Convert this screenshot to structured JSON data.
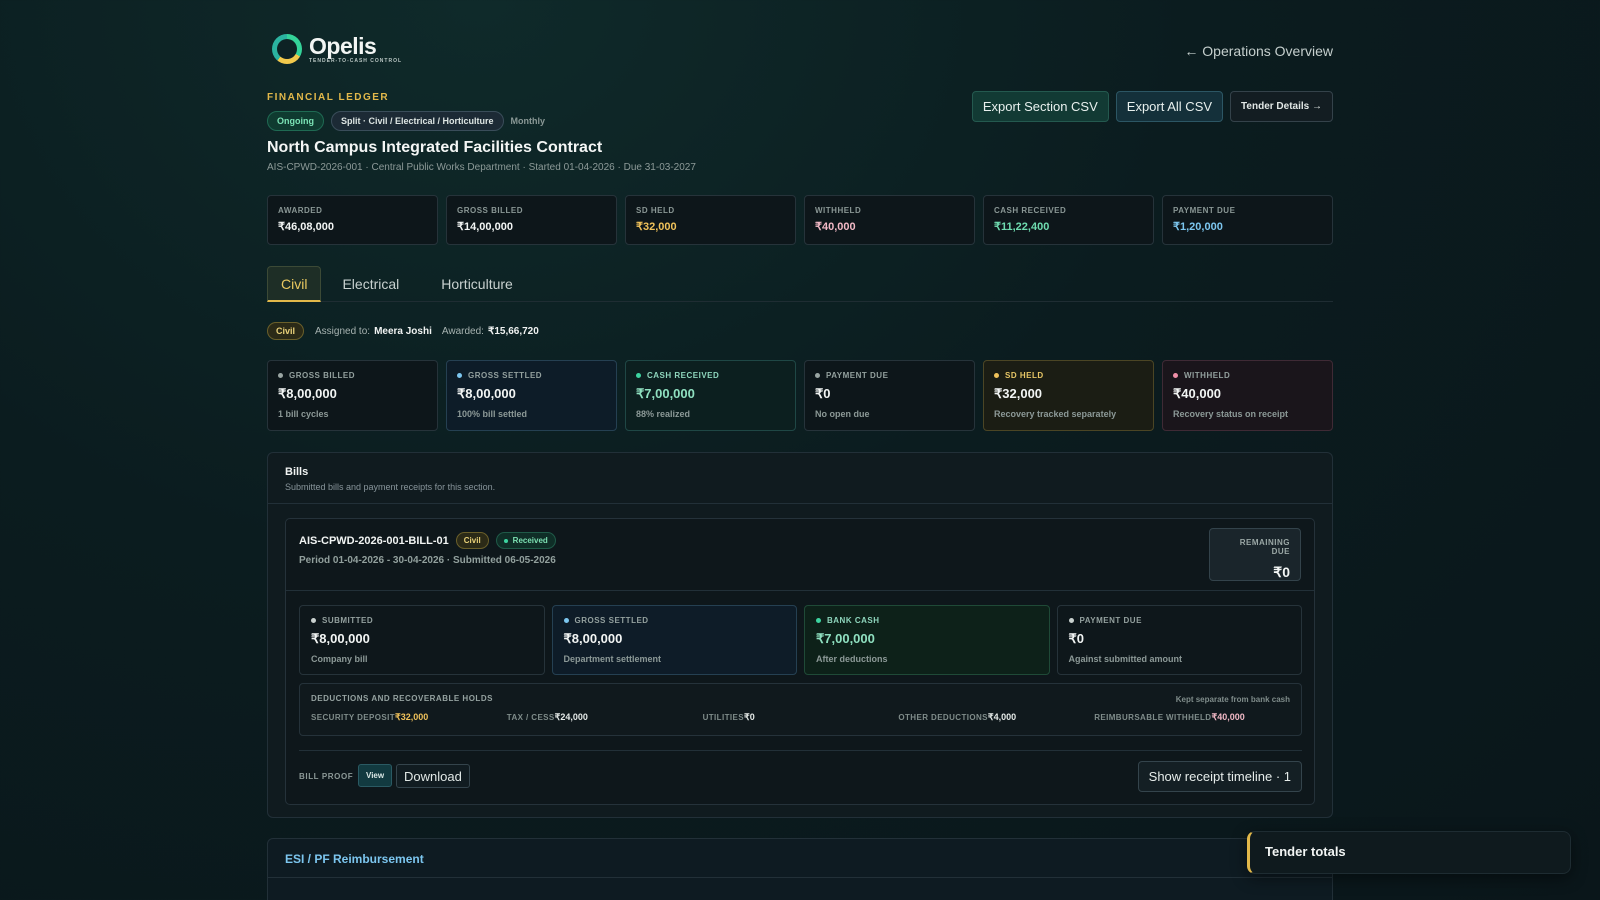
{
  "brand": {
    "name": "Opelis",
    "tagline": "TENDER-TO-CASH CONTROL"
  },
  "nav": {
    "back_link": "← Operations Overview"
  },
  "header": {
    "eyebrow": "FINANCIAL LEDGER",
    "status": "Ongoing",
    "split": "Split · Civil / Electrical / Horticulture",
    "frequency": "Monthly",
    "title": "North Campus Integrated Facilities Contract",
    "subtitle": "AIS-CPWD-2026-001 · Central Public Works Department · Started 01-04-2026 · Due 31-03-2027"
  },
  "actions": {
    "export_section": "Export Section CSV",
    "export_all": "Export All CSV",
    "tender_details": "Tender Details →"
  },
  "summary": [
    {
      "label": "AWARDED",
      "value": "₹46,08,000",
      "color": "#f2f5f4"
    },
    {
      "label": "GROSS BILLED",
      "value": "₹14,00,000",
      "color": "#f2f5f4"
    },
    {
      "label": "SD HELD",
      "value": "₹32,000",
      "color": "#f0c25a"
    },
    {
      "label": "WITHHELD",
      "value": "₹40,000",
      "color": "#f2b9c6"
    },
    {
      "label": "CASH RECEIVED",
      "value": "₹11,22,400",
      "color": "#6fdcb0"
    },
    {
      "label": "PAYMENT DUE",
      "value": "₹1,20,000",
      "color": "#7cc6ef"
    }
  ],
  "tabs": [
    {
      "label": "Civil",
      "active": true
    },
    {
      "label": "Electrical",
      "active": false
    },
    {
      "label": "Horticulture",
      "active": false
    }
  ],
  "section": {
    "badge": "Civil",
    "assigned_label": "Assigned to:",
    "assigned_to": "Meera Joshi",
    "awarded_label": "Awarded:",
    "awarded_value": "₹15,66,720"
  },
  "metrics": [
    {
      "label": "GROSS BILLED",
      "value": "₹8,00,000",
      "note": "1 bill cycles",
      "dot": "#9aa5a3"
    },
    {
      "label": "GROSS SETTLED",
      "value": "₹8,00,000",
      "note": "100% bill settled",
      "dot": "#7cc6ef"
    },
    {
      "label": "CASH RECEIVED",
      "value": "₹7,00,000",
      "note": "88% realized",
      "dot": "#3dd4a0"
    },
    {
      "label": "PAYMENT DUE",
      "value": "₹0",
      "note": "No open due",
      "dot": "#9aa5a3"
    },
    {
      "label": "SD HELD",
      "value": "₹32,000",
      "note": "Recovery tracked separately",
      "dot": "#f0c25a"
    },
    {
      "label": "WITHHELD",
      "value": "₹40,000",
      "note": "Recovery status on receipt",
      "dot": "#f08fa8"
    }
  ],
  "bills_section": {
    "title": "Bills",
    "subtitle": "Submitted bills and payment receipts for this section."
  },
  "bill": {
    "id": "AIS-CPWD-2026-001-BILL-01",
    "badge": "Civil",
    "status": "Received",
    "period": "Period 01-04-2026 - 30-04-2026 · Submitted 06-05-2026",
    "remaining_label": "REMAINING DUE",
    "remaining_value": "₹0",
    "metrics": [
      {
        "label": "SUBMITTED",
        "value": "₹8,00,000",
        "note": "Company bill",
        "dot": "#c9d1cf"
      },
      {
        "label": "GROSS SETTLED",
        "value": "₹8,00,000",
        "note": "Department settlement",
        "dot": "#7cc6ef"
      },
      {
        "label": "BANK CASH",
        "value": "₹7,00,000",
        "note": "After deductions",
        "dot": "#3dd4a0"
      },
      {
        "label": "PAYMENT DUE",
        "value": "₹0",
        "note": "Against submitted amount",
        "dot": "#c9d1cf"
      }
    ],
    "deductions": {
      "title": "DEDUCTIONS AND RECOVERABLE HOLDS",
      "note": "Kept separate from bank cash",
      "items": [
        {
          "label": "SECURITY DEPOSIT",
          "value": "₹32,000",
          "color": "#f0c25a"
        },
        {
          "label": "TAX / CESS",
          "value": "₹24,000",
          "color": "#e6ebe9"
        },
        {
          "label": "UTILITIES",
          "value": "₹0",
          "color": "#e6ebe9"
        },
        {
          "label": "OTHER DEDUCTIONS",
          "value": "₹4,000",
          "color": "#e6ebe9"
        },
        {
          "label": "REIMBURSABLE WITHHELD",
          "value": "₹40,000",
          "color": "#f2b9c6"
        }
      ]
    },
    "proof_label": "BILL PROOF",
    "view_label": "View",
    "download_label": "Download",
    "timeline_label": "Show receipt timeline · 1"
  },
  "esi": {
    "title": "ESI / PF Reimbursement"
  },
  "totals": {
    "title": "Tender totals"
  }
}
